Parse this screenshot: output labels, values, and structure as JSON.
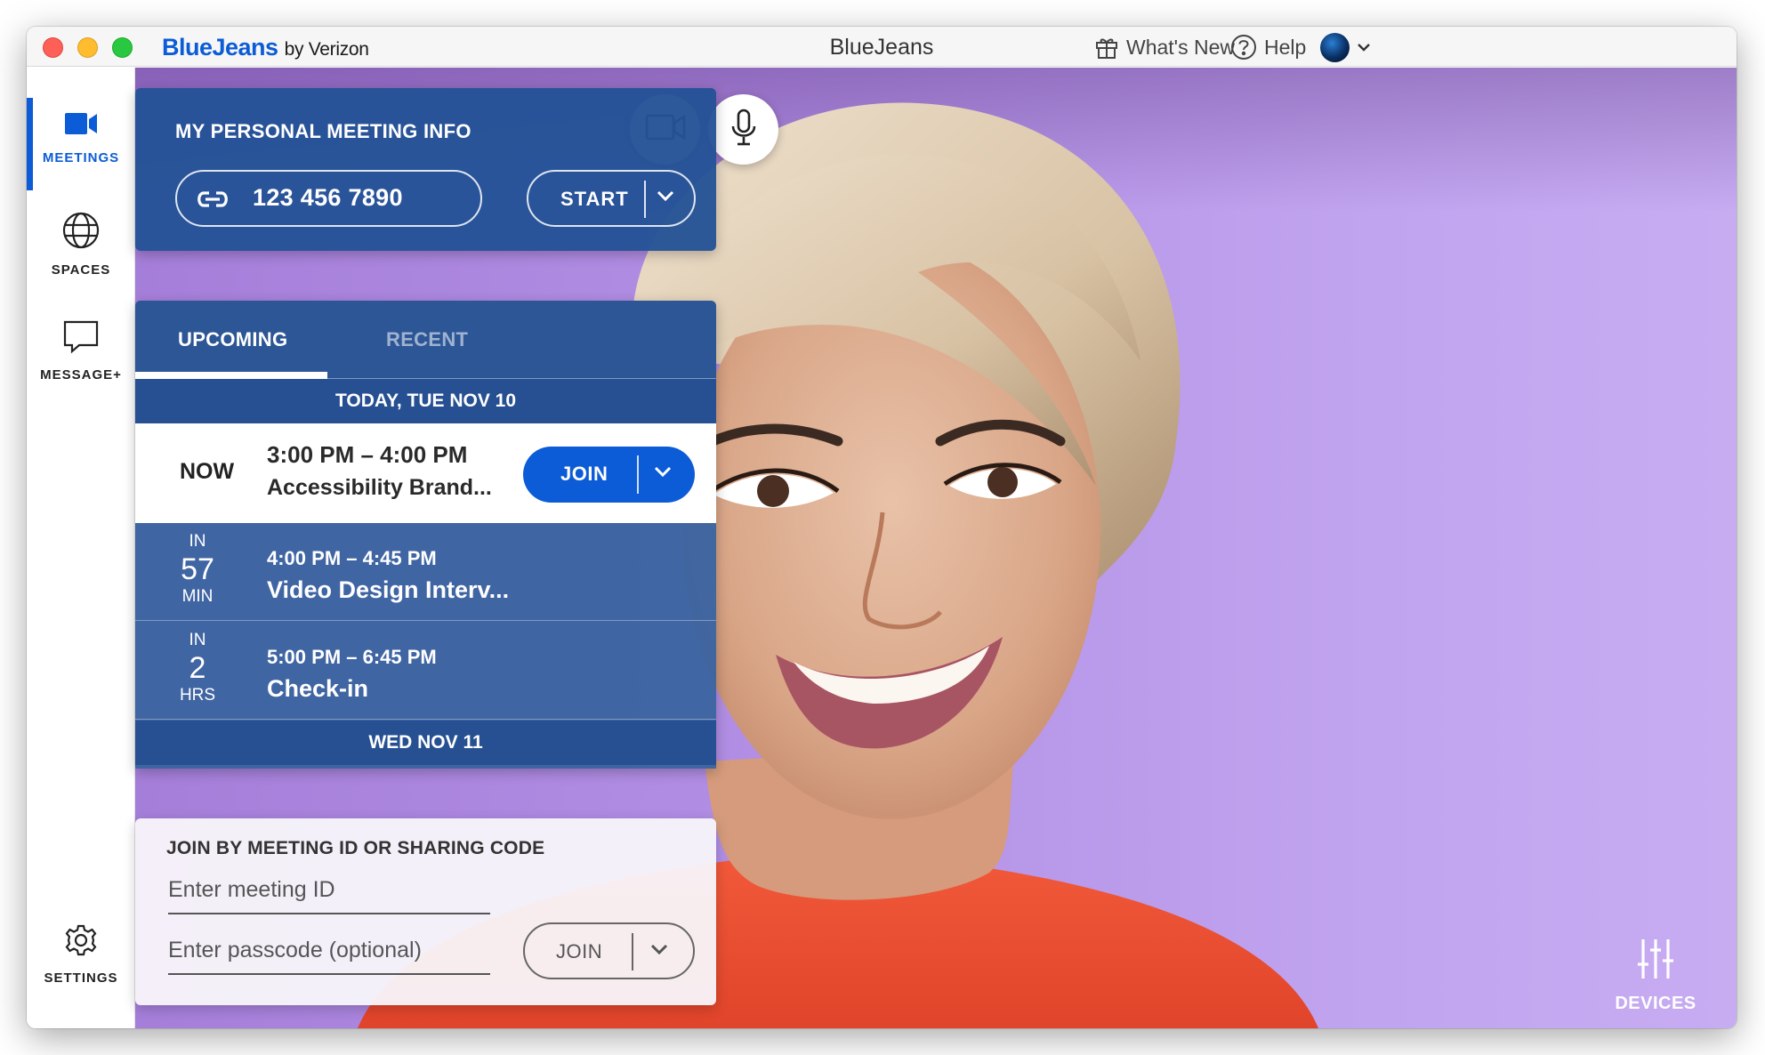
{
  "titlebar": {
    "brand": "BlueJeans",
    "brand_by": "by Verizon",
    "window_title": "BlueJeans",
    "whats_new": "What's New",
    "help": "Help"
  },
  "sidebar": {
    "items": [
      {
        "label": "MEETINGS",
        "icon": "video-camera-icon",
        "active": true
      },
      {
        "label": "SPACES",
        "icon": "globe-icon",
        "active": false
      },
      {
        "label": "MESSAGE+",
        "icon": "chat-bubble-icon",
        "active": false
      }
    ],
    "settings": "SETTINGS"
  },
  "personal_meeting": {
    "title": "MY PERSONAL MEETING INFO",
    "meeting_id": "123 456 7890",
    "start_label": "START"
  },
  "meetings": {
    "tabs": [
      "UPCOMING",
      "RECENT"
    ],
    "active_tab": "UPCOMING",
    "today_header": "TODAY, TUE NOV 10",
    "now_item": {
      "status": "NOW",
      "time": "3:00 PM – 4:00 PM",
      "name": "Accessibility Brand...",
      "join_label": "JOIN"
    },
    "items": [
      {
        "rel_top": "IN",
        "rel_num": "57",
        "rel_unit": "MIN",
        "time": "4:00 PM – 4:45 PM",
        "name": "Video Design Interv..."
      },
      {
        "rel_top": "IN",
        "rel_num": "2",
        "rel_unit": "HRS",
        "time": "5:00 PM – 6:45 PM",
        "name": "Check-in"
      }
    ],
    "next_day_header": "WED NOV 11"
  },
  "join_by_id": {
    "title": "JOIN BY MEETING ID OR SHARING CODE",
    "meeting_id_placeholder": "Enter meeting ID",
    "passcode_placeholder": "Enter passcode (optional)",
    "join_label": "JOIN"
  },
  "devices": {
    "label": "DEVICES"
  },
  "colors": {
    "accent": "#0b5cd6",
    "card_blue": "#2c5696",
    "background_purple": "#b28fe4"
  }
}
